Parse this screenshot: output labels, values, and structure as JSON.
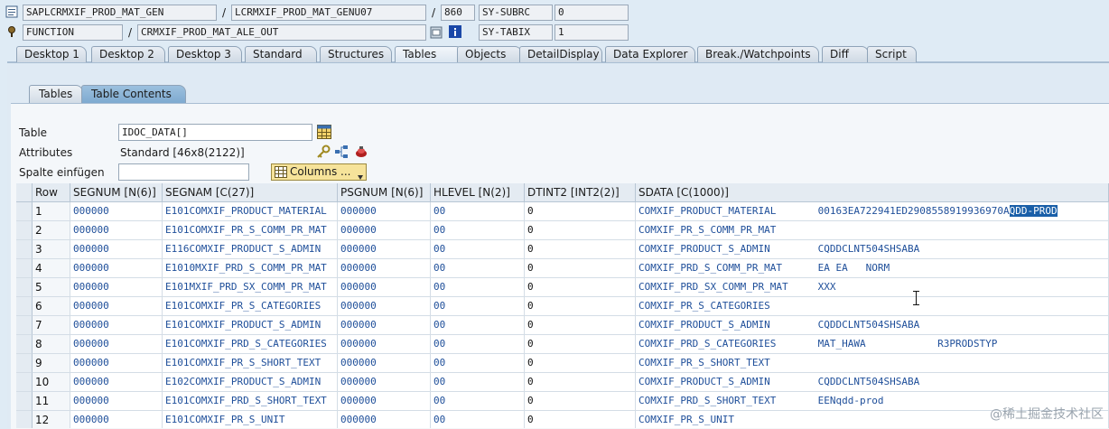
{
  "header": {
    "row1": {
      "program": "SAPLCRMXIF_PROD_MAT_GEN",
      "include": "LCRMXIF_PROD_MAT_GENU07",
      "line": "860",
      "var_name": "SY-SUBRC",
      "var_value": "0"
    },
    "row2": {
      "type": "FUNCTION",
      "name": "CRMXIF_PROD_MAT_ALE_OUT",
      "var_name": "SY-TABIX",
      "var_value": "1"
    },
    "sep": "/"
  },
  "tabs": [
    "Desktop 1",
    "Desktop 2",
    "Desktop 3",
    "Standard",
    "Structures",
    "Tables",
    "Objects",
    "DetailDisplay",
    "Data Explorer",
    "Break./Watchpoints",
    "Diff",
    "Script"
  ],
  "active_tab": "Tables",
  "subtabs": [
    "Tables",
    "Table Contents"
  ],
  "active_subtab": "Table Contents",
  "form": {
    "table_label": "Table",
    "table_value": "IDOC_DATA[]",
    "attributes_label": "Attributes",
    "attributes_value": "Standard [46x8(2122)]",
    "spalte_label": "Spalte einfügen",
    "spalte_value": "",
    "columns_button": "Columns ..."
  },
  "grid": {
    "columns": [
      "Row",
      "SEGNUM [N(6)]",
      "SEGNAM [C(27)]",
      "PSGNUM [N(6)]",
      "HLEVEL [N(2)]",
      "DTINT2 [INT2(2)]",
      "SDATA [C(1000)]"
    ],
    "rows": [
      [
        "1",
        "000000",
        "E101COMXIF_PRODUCT_MATERIAL",
        "000000",
        "00",
        "0",
        "COMXIF_PRODUCT_MATERIAL       00163EA722941ED2908558919936970A",
        "QDD-PROD"
      ],
      [
        "2",
        "000000",
        "E101COMXIF_PR_S_COMM_PR_MAT",
        "000000",
        "00",
        "0",
        "COMXIF_PR_S_COMM_PR_MAT",
        ""
      ],
      [
        "3",
        "000000",
        "E116COMXIF_PRODUCT_S_ADMIN",
        "000000",
        "00",
        "0",
        "COMXIF_PRODUCT_S_ADMIN        CQDDCLNT504SHSABA",
        ""
      ],
      [
        "4",
        "000000",
        "E1010MXIF_PRD_S_COMM_PR_MAT",
        "000000",
        "00",
        "0",
        "COMXIF_PRD_S_COMM_PR_MAT      EA EA   NORM",
        ""
      ],
      [
        "5",
        "000000",
        "E101MXIF_PRD_SX_COMM_PR_MAT",
        "000000",
        "00",
        "0",
        "COMXIF_PRD_SX_COMM_PR_MAT     XXX",
        ""
      ],
      [
        "6",
        "000000",
        "E101COMXIF_PR_S_CATEGORIES",
        "000000",
        "00",
        "0",
        "COMXIF_PR_S_CATEGORIES",
        ""
      ],
      [
        "7",
        "000000",
        "E101COMXIF_PRODUCT_S_ADMIN",
        "000000",
        "00",
        "0",
        "COMXIF_PRODUCT_S_ADMIN        CQDDCLNT504SHSABA",
        ""
      ],
      [
        "8",
        "000000",
        "E101COMXIF_PRD_S_CATEGORIES",
        "000000",
        "00",
        "0",
        "COMXIF_PRD_S_CATEGORIES       MAT_HAWA            R3PRODSTYP",
        ""
      ],
      [
        "9",
        "000000",
        "E101COMXIF_PR_S_SHORT_TEXT",
        "000000",
        "00",
        "0",
        "COMXIF_PR_S_SHORT_TEXT",
        ""
      ],
      [
        "10",
        "000000",
        "E102COMXIF_PRODUCT_S_ADMIN",
        "000000",
        "00",
        "0",
        "COMXIF_PRODUCT_S_ADMIN        CQDDCLNT504SHSABA",
        ""
      ],
      [
        "11",
        "000000",
        "E101COMXIF_PRD_S_SHORT_TEXT",
        "000000",
        "00",
        "0",
        "COMXIF_PRD_S_SHORT_TEXT       EENqdd-prod",
        ""
      ],
      [
        "12",
        "000000",
        "E101COMXIF_PR_S_UNIT",
        "000000",
        "00",
        "0",
        "COMXIF_PR_S_UNIT",
        ""
      ]
    ]
  },
  "watermark": "@稀土掘金技术社区",
  "colors": {
    "accent": "#1a5fa8",
    "link_text": "#1f4f9a",
    "background": "#dfebf5"
  }
}
